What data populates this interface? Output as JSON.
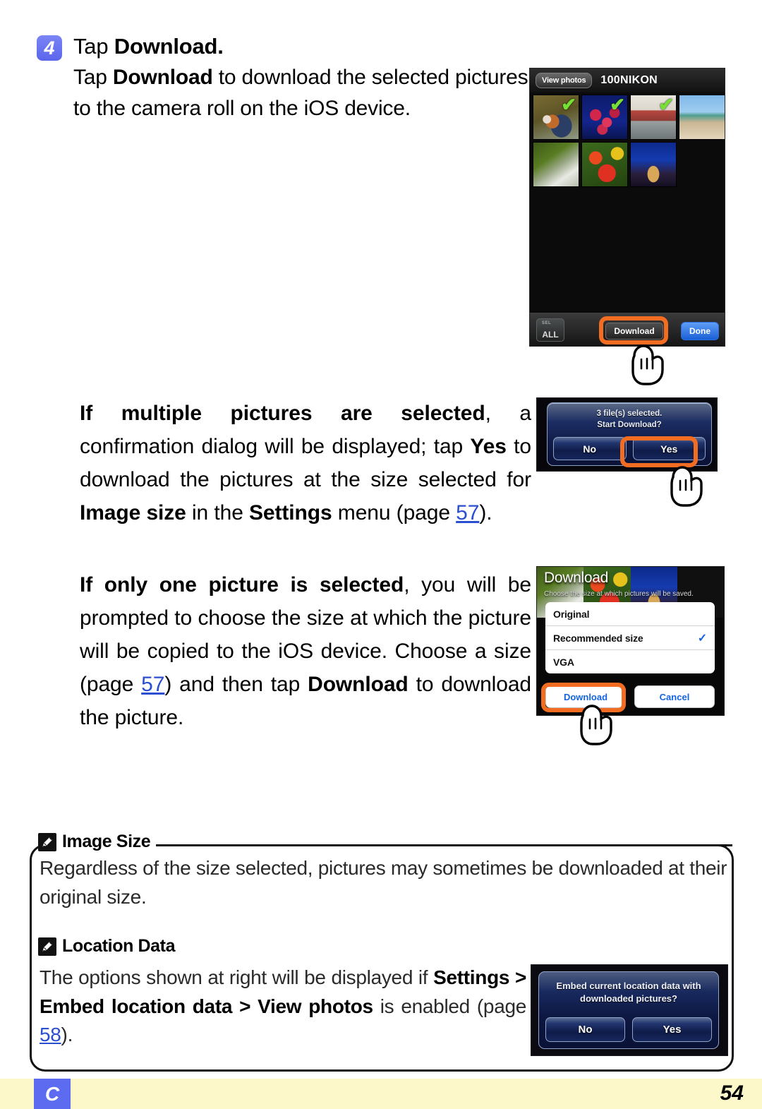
{
  "step": {
    "number": "4",
    "title_prefix": "Tap ",
    "title_bold": "Download.",
    "body_1": "Tap ",
    "body_bold": "Download",
    "body_2": " to download the selected pictures to the camera roll on the iOS device."
  },
  "paragraphs": {
    "multi": {
      "bold_lead": "If multiple pictures are selected",
      "text_a": ", a confirmation dialog will be displayed; tap ",
      "bold_yes": "Yes",
      "text_b": " to download the pictures at the size selected for ",
      "bold_imagesize": "Image size",
      "text_c": " in the ",
      "bold_settings": "Settings",
      "text_d": " menu (page ",
      "page_ref": "57",
      "text_e": ")."
    },
    "single": {
      "bold_lead": "If only one picture is selected",
      "text_a": ", you will be prompted to choose the size at which the picture will be copied to the iOS device. Choose a size (page ",
      "page_ref": "57",
      "text_b": ") and then tap ",
      "bold_download": "Download",
      "text_c": " to download the picture."
    }
  },
  "shot_gallery": {
    "view_photos_label": "View photos",
    "folder_title": "100NIKON",
    "thumbnails": [
      {
        "name": "mandarin-duck",
        "selected": true
      },
      {
        "name": "red-berries",
        "selected": true
      },
      {
        "name": "old-town",
        "selected": true
      },
      {
        "name": "beach-palms",
        "selected": false
      },
      {
        "name": "waterfall",
        "selected": false
      },
      {
        "name": "red-poppies",
        "selected": false
      },
      {
        "name": "night-house",
        "selected": false
      }
    ],
    "check_glyph": "✔",
    "all_button_top": "SEL",
    "all_button_label": "ALL",
    "download_label": "Download",
    "done_label": "Done"
  },
  "shot_confirm": {
    "message_line1": "3 file(s) selected.",
    "message_line2": "Start Download?",
    "no_label": "No",
    "yes_label": "Yes"
  },
  "shot_download_size": {
    "title": "Download",
    "subtitle": "Choose the size at which pictures will be saved.",
    "options": [
      {
        "label": "Original",
        "checked": false
      },
      {
        "label": "Recommended size",
        "checked": true
      },
      {
        "label": "VGA",
        "checked": false
      }
    ],
    "check_glyph": "✓",
    "download_label": "Download",
    "cancel_label": "Cancel"
  },
  "notes": {
    "note1": {
      "title": "Image Size",
      "text": "Regardless of the size selected, pictures may sometimes be downloaded at their original size."
    },
    "note2": {
      "title": "Location Data",
      "text_a": "The options shown at right will be displayed if ",
      "bold_settings": "Settings",
      "gt1": " > ",
      "bold_embed": "Embed location data",
      "gt2": " > ",
      "bold_viewphotos": "View photos",
      "text_b": " is enabled (page ",
      "page_ref": "58",
      "text_c": ")."
    }
  },
  "shot_location": {
    "message_line1": "Embed current location data with",
    "message_line2": "downloaded pictures?",
    "no_label": "No",
    "yes_label": "Yes"
  },
  "footer": {
    "badge": "C",
    "page_number": "54"
  },
  "colors": {
    "accent_orange": "#f26c22",
    "step_blue": "#5c6bf0",
    "footer_yellow": "#fdf8c9",
    "link_blue": "#2b4fd0",
    "check_green": "#76e034"
  }
}
